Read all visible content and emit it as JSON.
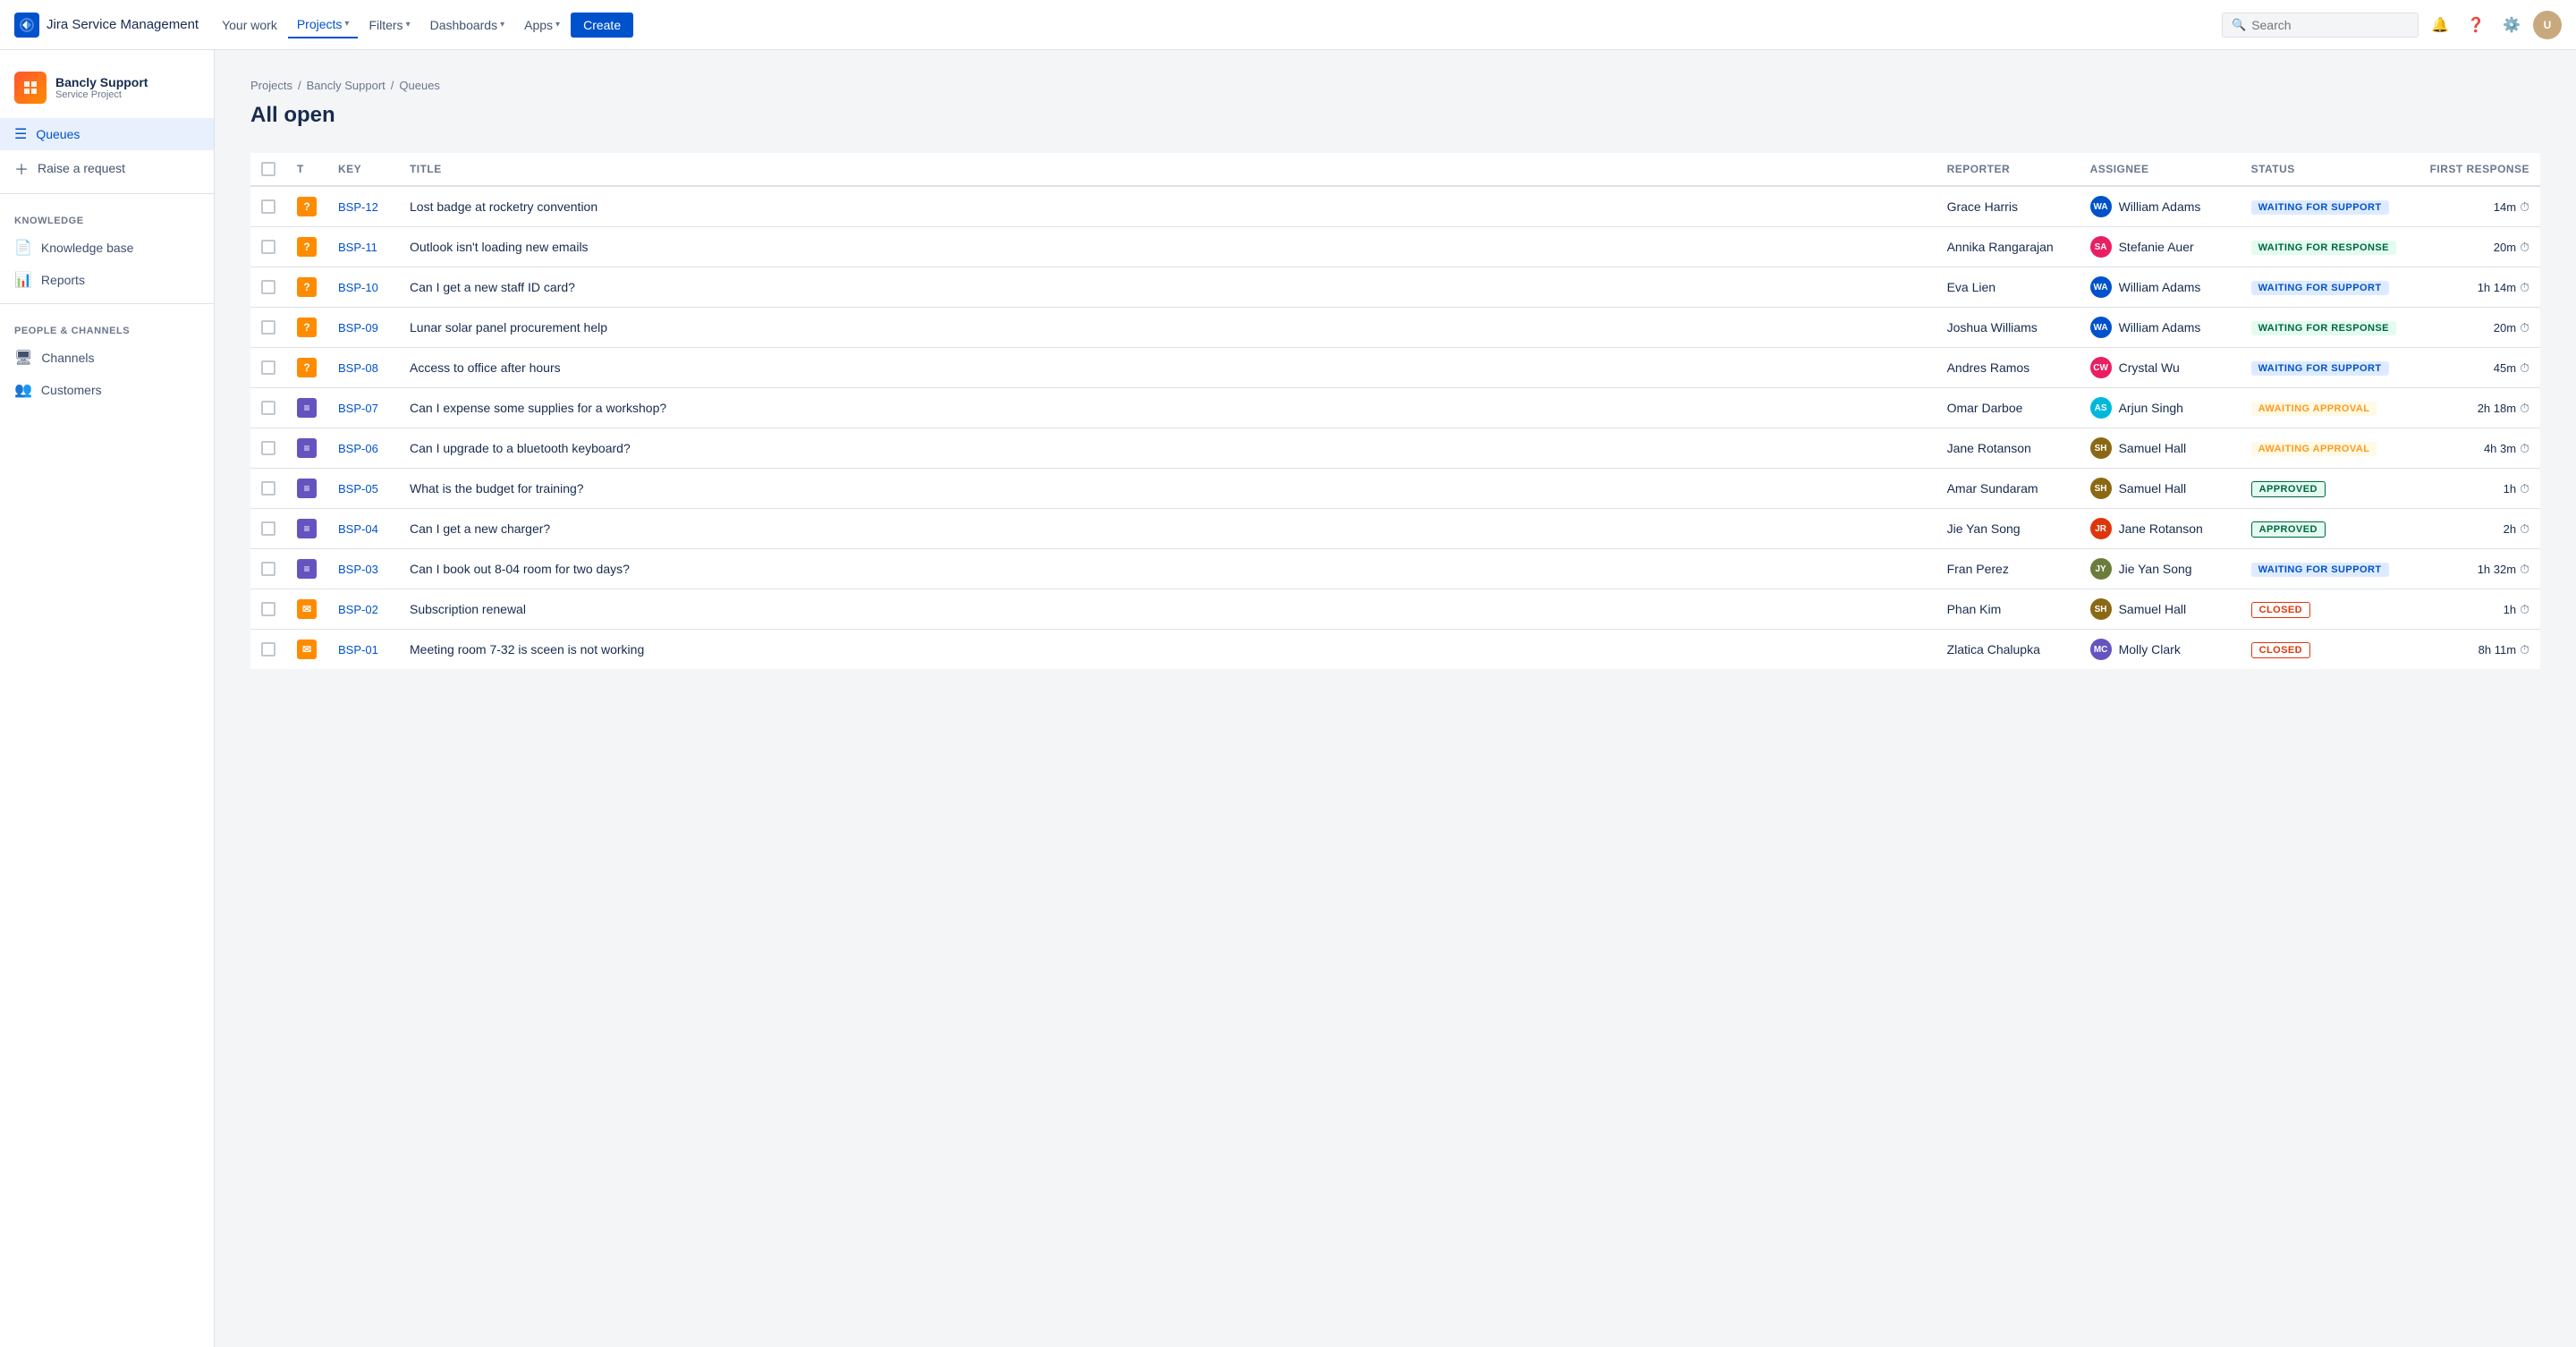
{
  "app": {
    "name": "Jira Service Management"
  },
  "topnav": {
    "your_work": "Your work",
    "projects": "Projects",
    "filters": "Filters",
    "dashboards": "Dashboards",
    "apps": "Apps",
    "create": "Create",
    "search_placeholder": "Search"
  },
  "sidebar": {
    "project_name": "Bancly Support",
    "project_type": "Service Project",
    "queues_label": "Queues",
    "raise_request_label": "Raise a request",
    "knowledge_section": "Knowledge",
    "knowledge_base_label": "Knowledge base",
    "reports_label": "Reports",
    "people_channels_section": "People & Channels",
    "channels_label": "Channels",
    "customers_label": "Customers"
  },
  "breadcrumb": {
    "projects": "Projects",
    "bancly_support": "Bancly Support",
    "queues": "Queues"
  },
  "page": {
    "title": "All open"
  },
  "table": {
    "headers": {
      "t": "T",
      "key": "Key",
      "title": "Title",
      "reporter": "Reporter",
      "assignee": "Assignee",
      "status": "Status",
      "first_response": "First response"
    },
    "rows": [
      {
        "key": "BSP-12",
        "type": "question",
        "title": "Lost badge at rocketry convention",
        "reporter": "Grace Harris",
        "assignee": "William Adams",
        "assignee_initials": "WA",
        "assignee_color": "av-blue",
        "status": "WAITING FOR SUPPORT",
        "status_class": "status-waiting-support",
        "first_response": "14m"
      },
      {
        "key": "BSP-11",
        "type": "question",
        "title": "Outlook isn't loading new emails",
        "reporter": "Annika Rangarajan",
        "assignee": "Stefanie Auer",
        "assignee_initials": "SA",
        "assignee_color": "av-pink",
        "status": "WAITING FOR RESPONSE",
        "status_class": "status-waiting-response",
        "first_response": "20m"
      },
      {
        "key": "BSP-10",
        "type": "question",
        "title": "Can I get a new staff ID card?",
        "reporter": "Eva Lien",
        "assignee": "William Adams",
        "assignee_initials": "WA",
        "assignee_color": "av-blue",
        "status": "WAITING FOR SUPPORT",
        "status_class": "status-waiting-support",
        "first_response": "1h 14m"
      },
      {
        "key": "BSP-09",
        "type": "question",
        "title": "Lunar solar panel procurement help",
        "reporter": "Joshua Williams",
        "assignee": "William Adams",
        "assignee_initials": "WA",
        "assignee_color": "av-blue",
        "status": "WAITING FOR RESPONSE",
        "status_class": "status-waiting-response",
        "first_response": "20m"
      },
      {
        "key": "BSP-08",
        "type": "question",
        "title": "Access to office after hours",
        "reporter": "Andres Ramos",
        "assignee": "Crystal Wu",
        "assignee_initials": "CW",
        "assignee_color": "av-pink",
        "status": "WAITING FOR SUPPORT",
        "status_class": "status-waiting-support",
        "first_response": "45m"
      },
      {
        "key": "BSP-07",
        "type": "service",
        "title": "Can I expense some supplies for a workshop?",
        "reporter": "Omar Darboe",
        "assignee": "Arjun Singh",
        "assignee_initials": "AS",
        "assignee_color": "av-teal",
        "status": "AWAITING APPROVAL",
        "status_class": "status-awaiting-approval",
        "first_response": "2h 18m"
      },
      {
        "key": "BSP-06",
        "type": "service",
        "title": "Can I upgrade to a bluetooth keyboard?",
        "reporter": "Jane Rotanson",
        "assignee": "Samuel Hall",
        "assignee_initials": "SH",
        "assignee_color": "av-brown",
        "status": "AWAITING APPROVAL",
        "status_class": "status-awaiting-approval",
        "first_response": "4h 3m"
      },
      {
        "key": "BSP-05",
        "type": "service",
        "title": "What is the budget for training?",
        "reporter": "Amar Sundaram",
        "assignee": "Samuel Hall",
        "assignee_initials": "SH",
        "assignee_color": "av-brown",
        "status": "APPROVED",
        "status_class": "status-approved",
        "first_response": "1h"
      },
      {
        "key": "BSP-04",
        "type": "service",
        "title": "Can I get a new charger?",
        "reporter": "Jie Yan Song",
        "assignee": "Jane Rotanson",
        "assignee_initials": "JR",
        "assignee_color": "av-red",
        "status": "APPROVED",
        "status_class": "status-approved",
        "first_response": "2h"
      },
      {
        "key": "BSP-03",
        "type": "service",
        "title": "Can I book out 8-04 room for two days?",
        "reporter": "Fran Perez",
        "assignee": "Jie Yan Song",
        "assignee_initials": "JY",
        "assignee_color": "av-olive",
        "status": "WAITING FOR SUPPORT",
        "status_class": "status-waiting-support",
        "first_response": "1h 32m"
      },
      {
        "key": "BSP-02",
        "type": "email",
        "title": "Subscription renewal",
        "reporter": "Phan Kim",
        "assignee": "Samuel Hall",
        "assignee_initials": "SH",
        "assignee_color": "av-brown",
        "status": "CLOSED",
        "status_class": "status-closed",
        "first_response": "1h"
      },
      {
        "key": "BSP-01",
        "type": "email",
        "title": "Meeting room 7-32 is sceen is not working",
        "reporter": "Zlatica Chalupka",
        "assignee": "Molly Clark",
        "assignee_initials": "MC",
        "assignee_color": "av-purple",
        "status": "CLOSED",
        "status_class": "status-closed",
        "first_response": "8h 11m"
      }
    ]
  }
}
